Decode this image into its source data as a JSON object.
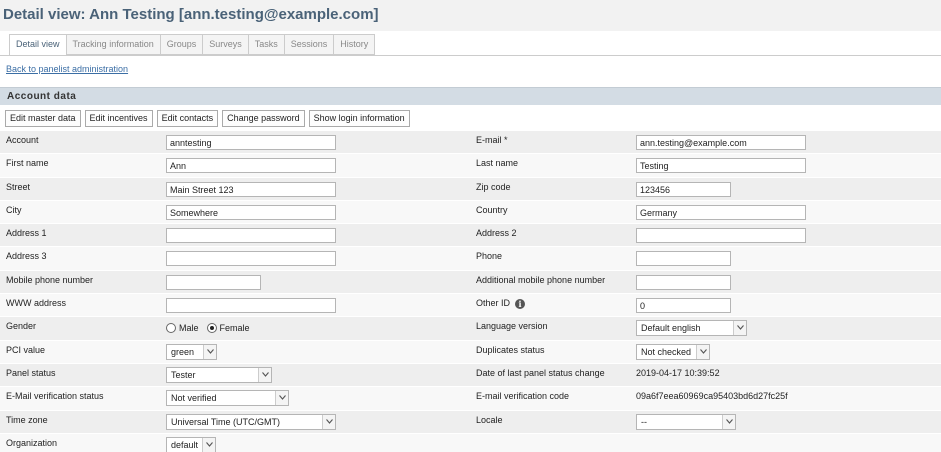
{
  "page": {
    "title": "Detail view: Ann Testing [ann.testing@example.com]"
  },
  "tabs": [
    {
      "label": "Detail view",
      "active": true
    },
    {
      "label": "Tracking information",
      "active": false
    },
    {
      "label": "Groups",
      "active": false
    },
    {
      "label": "Surveys",
      "active": false
    },
    {
      "label": "Tasks",
      "active": false
    },
    {
      "label": "Sessions",
      "active": false
    },
    {
      "label": "History",
      "active": false
    }
  ],
  "back_link": "Back to panelist administration",
  "section": {
    "title": "Account data"
  },
  "buttons": {
    "edit_master_data": "Edit master data",
    "edit_incentives": "Edit incentives",
    "edit_contacts": "Edit contacts",
    "change_password": "Change password",
    "show_login_information": "Show login information"
  },
  "fields": {
    "account": {
      "label": "Account",
      "value": "anntesting"
    },
    "email": {
      "label": "E-mail *",
      "value": "ann.testing@example.com"
    },
    "first_name": {
      "label": "First name",
      "value": "Ann"
    },
    "last_name": {
      "label": "Last name",
      "value": "Testing"
    },
    "street": {
      "label": "Street",
      "value": "Main Street 123"
    },
    "zip_code": {
      "label": "Zip code",
      "value": "123456"
    },
    "city": {
      "label": "City",
      "value": "Somewhere"
    },
    "country": {
      "label": "Country",
      "value": "Germany"
    },
    "address1": {
      "label": "Address 1",
      "value": ""
    },
    "address2": {
      "label": "Address 2",
      "value": ""
    },
    "address3": {
      "label": "Address 3",
      "value": ""
    },
    "phone": {
      "label": "Phone",
      "value": ""
    },
    "mobile_phone": {
      "label": "Mobile phone number",
      "value": ""
    },
    "additional_mobile_phone": {
      "label": "Additional mobile phone number",
      "value": ""
    },
    "www_address": {
      "label": "WWW address",
      "value": ""
    },
    "other_id": {
      "label": "Other ID",
      "value": "0",
      "icon": "info-icon"
    },
    "gender": {
      "label": "Gender",
      "options": [
        "Male",
        "Female"
      ],
      "selected": "Female"
    },
    "language_version": {
      "label": "Language version",
      "value": "Default english"
    },
    "pci_value": {
      "label": "PCI value",
      "value": "green"
    },
    "duplicates_status": {
      "label": "Duplicates status",
      "value": "Not checked"
    },
    "panel_status": {
      "label": "Panel status",
      "value": "Tester"
    },
    "last_panel_status_change": {
      "label": "Date of last panel status change",
      "value": "2019-04-17 10:39:52"
    },
    "email_verification_status": {
      "label": "E-Mail verification status",
      "value": "Not verified"
    },
    "email_verification_code": {
      "label": "E-mail verification code",
      "value": "09a6f7eea60969ca95403bd6d27fc25f"
    },
    "time_zone": {
      "label": "Time zone",
      "value": "Universal Time (UTC/GMT)"
    },
    "locale": {
      "label": "Locale",
      "value": "--"
    },
    "organization": {
      "label": "Organization",
      "value": "default"
    }
  },
  "colors": {
    "title": "#4a6278",
    "link": "#3b6ea5",
    "section_header": "#d3dce4",
    "row_odd": "#eeeeee",
    "row_even": "#f8f8f8"
  }
}
